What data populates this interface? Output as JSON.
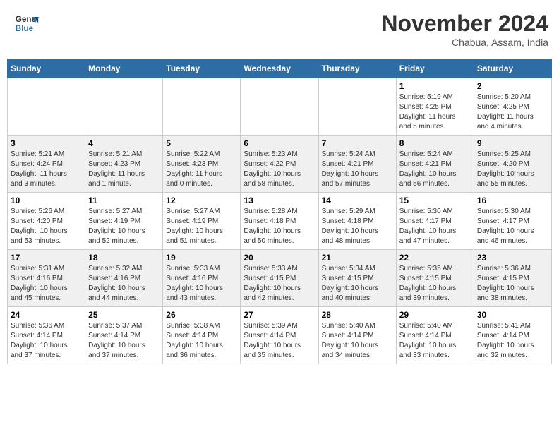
{
  "header": {
    "logo_line1": "General",
    "logo_line2": "Blue",
    "month": "November 2024",
    "location": "Chabua, Assam, India"
  },
  "weekdays": [
    "Sunday",
    "Monday",
    "Tuesday",
    "Wednesday",
    "Thursday",
    "Friday",
    "Saturday"
  ],
  "weeks": [
    [
      {
        "day": "",
        "info": ""
      },
      {
        "day": "",
        "info": ""
      },
      {
        "day": "",
        "info": ""
      },
      {
        "day": "",
        "info": ""
      },
      {
        "day": "",
        "info": ""
      },
      {
        "day": "1",
        "info": "Sunrise: 5:19 AM\nSunset: 4:25 PM\nDaylight: 11 hours\nand 5 minutes."
      },
      {
        "day": "2",
        "info": "Sunrise: 5:20 AM\nSunset: 4:25 PM\nDaylight: 11 hours\nand 4 minutes."
      }
    ],
    [
      {
        "day": "3",
        "info": "Sunrise: 5:21 AM\nSunset: 4:24 PM\nDaylight: 11 hours\nand 3 minutes."
      },
      {
        "day": "4",
        "info": "Sunrise: 5:21 AM\nSunset: 4:23 PM\nDaylight: 11 hours\nand 1 minute."
      },
      {
        "day": "5",
        "info": "Sunrise: 5:22 AM\nSunset: 4:23 PM\nDaylight: 11 hours\nand 0 minutes."
      },
      {
        "day": "6",
        "info": "Sunrise: 5:23 AM\nSunset: 4:22 PM\nDaylight: 10 hours\nand 58 minutes."
      },
      {
        "day": "7",
        "info": "Sunrise: 5:24 AM\nSunset: 4:21 PM\nDaylight: 10 hours\nand 57 minutes."
      },
      {
        "day": "8",
        "info": "Sunrise: 5:24 AM\nSunset: 4:21 PM\nDaylight: 10 hours\nand 56 minutes."
      },
      {
        "day": "9",
        "info": "Sunrise: 5:25 AM\nSunset: 4:20 PM\nDaylight: 10 hours\nand 55 minutes."
      }
    ],
    [
      {
        "day": "10",
        "info": "Sunrise: 5:26 AM\nSunset: 4:20 PM\nDaylight: 10 hours\nand 53 minutes."
      },
      {
        "day": "11",
        "info": "Sunrise: 5:27 AM\nSunset: 4:19 PM\nDaylight: 10 hours\nand 52 minutes."
      },
      {
        "day": "12",
        "info": "Sunrise: 5:27 AM\nSunset: 4:19 PM\nDaylight: 10 hours\nand 51 minutes."
      },
      {
        "day": "13",
        "info": "Sunrise: 5:28 AM\nSunset: 4:18 PM\nDaylight: 10 hours\nand 50 minutes."
      },
      {
        "day": "14",
        "info": "Sunrise: 5:29 AM\nSunset: 4:18 PM\nDaylight: 10 hours\nand 48 minutes."
      },
      {
        "day": "15",
        "info": "Sunrise: 5:30 AM\nSunset: 4:17 PM\nDaylight: 10 hours\nand 47 minutes."
      },
      {
        "day": "16",
        "info": "Sunrise: 5:30 AM\nSunset: 4:17 PM\nDaylight: 10 hours\nand 46 minutes."
      }
    ],
    [
      {
        "day": "17",
        "info": "Sunrise: 5:31 AM\nSunset: 4:16 PM\nDaylight: 10 hours\nand 45 minutes."
      },
      {
        "day": "18",
        "info": "Sunrise: 5:32 AM\nSunset: 4:16 PM\nDaylight: 10 hours\nand 44 minutes."
      },
      {
        "day": "19",
        "info": "Sunrise: 5:33 AM\nSunset: 4:16 PM\nDaylight: 10 hours\nand 43 minutes."
      },
      {
        "day": "20",
        "info": "Sunrise: 5:33 AM\nSunset: 4:15 PM\nDaylight: 10 hours\nand 42 minutes."
      },
      {
        "day": "21",
        "info": "Sunrise: 5:34 AM\nSunset: 4:15 PM\nDaylight: 10 hours\nand 40 minutes."
      },
      {
        "day": "22",
        "info": "Sunrise: 5:35 AM\nSunset: 4:15 PM\nDaylight: 10 hours\nand 39 minutes."
      },
      {
        "day": "23",
        "info": "Sunrise: 5:36 AM\nSunset: 4:15 PM\nDaylight: 10 hours\nand 38 minutes."
      }
    ],
    [
      {
        "day": "24",
        "info": "Sunrise: 5:36 AM\nSunset: 4:14 PM\nDaylight: 10 hours\nand 37 minutes."
      },
      {
        "day": "25",
        "info": "Sunrise: 5:37 AM\nSunset: 4:14 PM\nDaylight: 10 hours\nand 37 minutes."
      },
      {
        "day": "26",
        "info": "Sunrise: 5:38 AM\nSunset: 4:14 PM\nDaylight: 10 hours\nand 36 minutes."
      },
      {
        "day": "27",
        "info": "Sunrise: 5:39 AM\nSunset: 4:14 PM\nDaylight: 10 hours\nand 35 minutes."
      },
      {
        "day": "28",
        "info": "Sunrise: 5:40 AM\nSunset: 4:14 PM\nDaylight: 10 hours\nand 34 minutes."
      },
      {
        "day": "29",
        "info": "Sunrise: 5:40 AM\nSunset: 4:14 PM\nDaylight: 10 hours\nand 33 minutes."
      },
      {
        "day": "30",
        "info": "Sunrise: 5:41 AM\nSunset: 4:14 PM\nDaylight: 10 hours\nand 32 minutes."
      }
    ]
  ]
}
